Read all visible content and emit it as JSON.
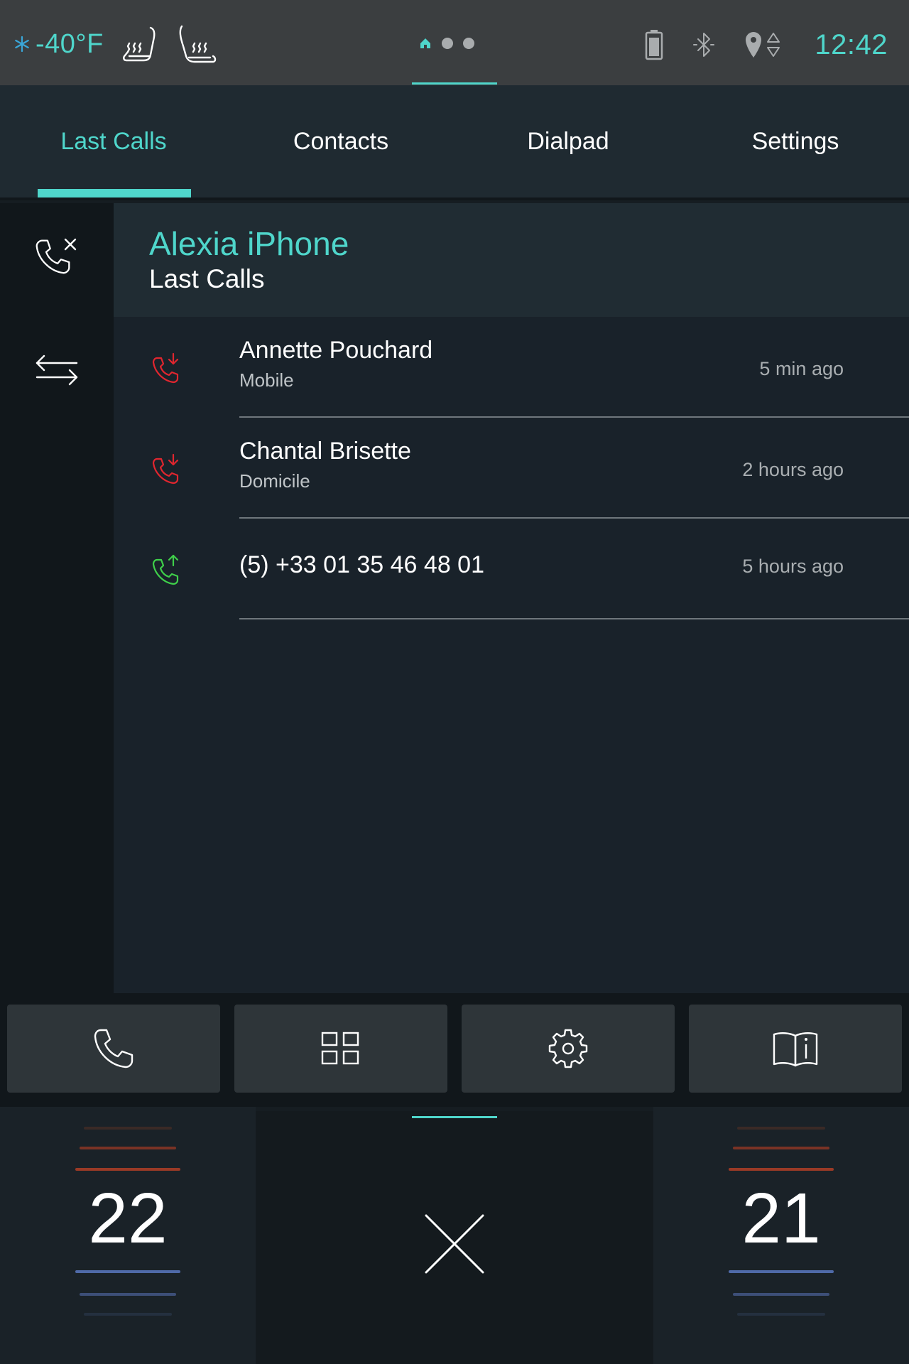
{
  "status": {
    "temperature": "-40°F",
    "time": "12:42"
  },
  "tabs": [
    {
      "label": "Last Calls",
      "active": true
    },
    {
      "label": "Contacts",
      "active": false
    },
    {
      "label": "Dialpad",
      "active": false
    },
    {
      "label": "Settings",
      "active": false
    }
  ],
  "header": {
    "device_name": "Alexia iPhone",
    "section": "Last Calls"
  },
  "calls": [
    {
      "name": "Annette Pouchard",
      "type": "Mobile",
      "time": "5 min ago",
      "direction": "missed-incoming",
      "icon": "missed-call-icon",
      "color": "#e0262f"
    },
    {
      "name": "Chantal Brisette",
      "type": "Domicile",
      "time": "2 hours ago",
      "direction": "missed-incoming",
      "icon": "missed-call-icon",
      "color": "#e0262f"
    },
    {
      "name": "(5) +33 01 35 46 48 01",
      "type": "",
      "time": "5 hours ago",
      "direction": "outgoing",
      "icon": "outgoing-call-icon",
      "color": "#3fcf4a"
    }
  ],
  "climate": {
    "left_temp": "22",
    "right_temp": "21"
  },
  "colors": {
    "accent": "#4fd6cb",
    "missed": "#e0262f",
    "outgoing": "#3fcf4a"
  }
}
